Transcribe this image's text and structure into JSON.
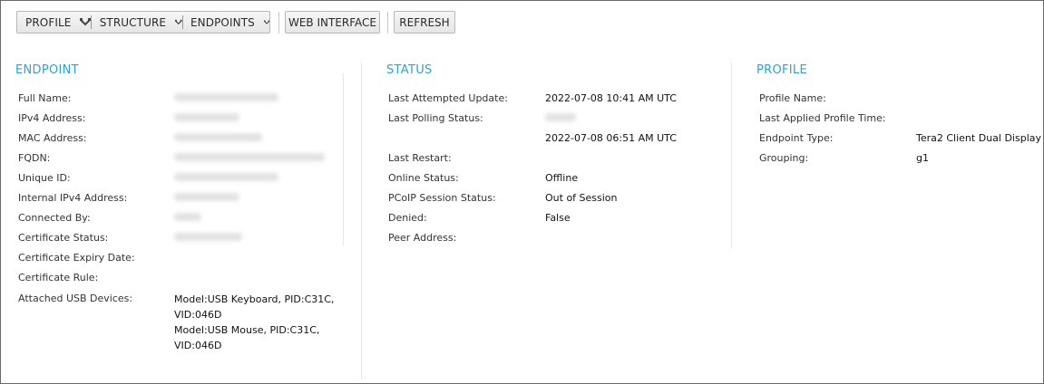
{
  "toolbar": {
    "group": [
      {
        "label": "PROFILE"
      },
      {
        "label": "STRUCTURE"
      },
      {
        "label": "ENDPOINTS"
      }
    ],
    "web_interface": "WEB INTERFACE",
    "refresh": "REFRESH"
  },
  "endpoint": {
    "title": "ENDPOINT",
    "fields": [
      {
        "label": "Full Name:",
        "value": ""
      },
      {
        "label": "IPv4 Address:",
        "value": ""
      },
      {
        "label": "MAC Address:",
        "value": ""
      },
      {
        "label": "FQDN:",
        "value": ""
      },
      {
        "label": "Unique ID:",
        "value": ""
      },
      {
        "label": "Internal IPv4 Address:",
        "value": ""
      },
      {
        "label": "Connected By:",
        "value": ""
      },
      {
        "label": "Certificate Status:",
        "value": ""
      },
      {
        "label": "Certificate Expiry Date:",
        "value": ""
      },
      {
        "label": "Certificate Rule:",
        "value": ""
      },
      {
        "label": "Attached USB Devices:",
        "value": ""
      }
    ],
    "usb_devices": [
      "Model:USB Keyboard, PID:C31C,",
      "VID:046D",
      "Model:USB Mouse, PID:C31C,",
      "VID:046D"
    ]
  },
  "status": {
    "title": "STATUS",
    "fields": [
      {
        "label": "Last Attempted Update:",
        "value": "2022-07-08 10:41 AM UTC"
      },
      {
        "label": "Last Polling Status:",
        "value": ""
      },
      {
        "label": "",
        "value": "2022-07-08 06:51 AM UTC"
      },
      {
        "label": "Last Restart:",
        "value": ""
      },
      {
        "label": "Online Status:",
        "value": "Offline"
      },
      {
        "label": "PCoIP Session Status:",
        "value": "Out of Session"
      },
      {
        "label": "Denied:",
        "value": "False"
      },
      {
        "label": "Peer Address:",
        "value": ""
      }
    ]
  },
  "profile": {
    "title": "PROFILE",
    "fields": [
      {
        "label": "Profile Name:",
        "value": ""
      },
      {
        "label": "Last Applied Profile Time:",
        "value": ""
      },
      {
        "label": "Endpoint Type:",
        "value": "Tera2 Client Dual Display"
      },
      {
        "label": "Grouping:",
        "value": "g1"
      }
    ]
  }
}
